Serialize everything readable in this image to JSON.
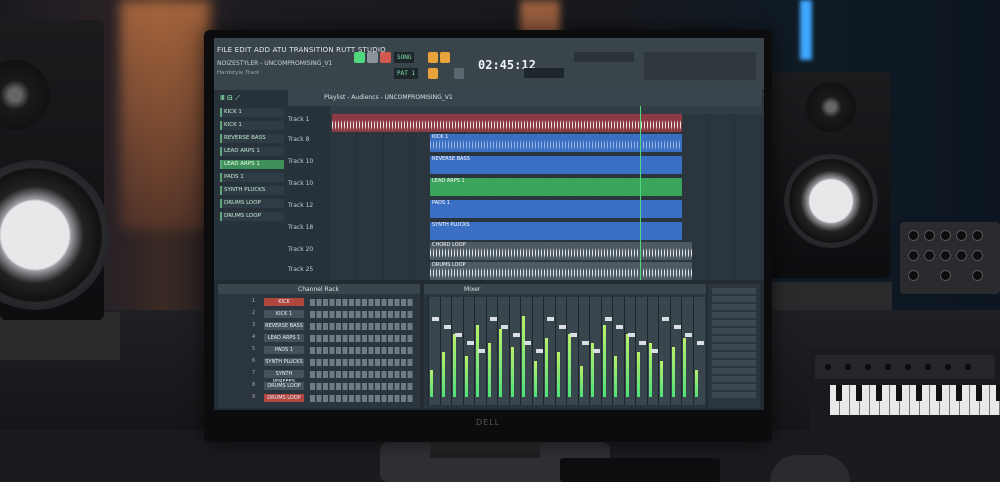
{
  "daw": {
    "menu": "FILE EDIT ADD ATU TRANSITION RUTT STUDIO",
    "project_name": "NOIZESTYLER - UNCOMPROMISING_V1",
    "hint_text": "Hardstyle Track",
    "time_display": "02:45:12",
    "tempo": "SONG",
    "pattern": "PAT 1"
  },
  "browser": {
    "items": [
      {
        "label": "KICK 1"
      },
      {
        "label": "KICK 1"
      },
      {
        "label": "REVERSE BASS"
      },
      {
        "label": "LEAD ARPS 1"
      },
      {
        "label": "LEAD ARPS 1"
      },
      {
        "label": "PADS 1"
      },
      {
        "label": "SYNTH PLUCKS"
      },
      {
        "label": "DRUMS LOOP"
      },
      {
        "label": "DRUMS LOOP"
      }
    ]
  },
  "playlist": {
    "title": "Playlist - Audiencs - UNCOMPROMISING_V1",
    "tracks": [
      {
        "label": "Track 1"
      },
      {
        "label": "Track 8"
      },
      {
        "label": "Track 10"
      },
      {
        "label": "Track 10"
      },
      {
        "label": "Track 12"
      },
      {
        "label": "Track 18"
      },
      {
        "label": "Track 20"
      },
      {
        "label": "Track 25"
      }
    ],
    "clips": [
      {
        "title": "KICK 1"
      },
      {
        "title": "REVERSE BASS"
      },
      {
        "title": "LEAD ARPS 1"
      },
      {
        "title": "PADS 1"
      },
      {
        "title": "SYNTH PLUCKS"
      },
      {
        "title": "CHORD LOOP"
      },
      {
        "title": "DRUMS LOOP"
      }
    ]
  },
  "channel_rack": {
    "title": "Channel Rack",
    "channels": [
      {
        "name": "KICK",
        "num": "1"
      },
      {
        "name": "KICK 1",
        "num": "2"
      },
      {
        "name": "REVERSE BASS",
        "num": "3"
      },
      {
        "name": "LEAD ARPS 1",
        "num": "4"
      },
      {
        "name": "PADS 1",
        "num": "5"
      },
      {
        "name": "SYNTH PLUCKS",
        "num": "6"
      },
      {
        "name": "SYNTH PERFEES",
        "num": "7"
      },
      {
        "name": "DRUMS LOOP",
        "num": "8"
      },
      {
        "name": "DRUMS LOOP",
        "num": "9"
      }
    ]
  },
  "mixer": {
    "title": "Mixer",
    "levels": [
      0.3,
      0.5,
      0.7,
      0.45,
      0.8,
      0.6,
      0.75,
      0.55,
      0.9,
      0.4,
      0.65,
      0.5,
      0.7,
      0.35,
      0.6,
      0.8,
      0.45,
      0.7,
      0.5,
      0.6,
      0.4,
      0.55,
      0.65,
      0.3
    ]
  },
  "monitor": {
    "brand": "DELL"
  },
  "colors": {
    "accent": "#4fd87c",
    "clip_blue": "#3b6fc4",
    "clip_green": "#3aa45a",
    "clip_red": "#b04a4a"
  }
}
